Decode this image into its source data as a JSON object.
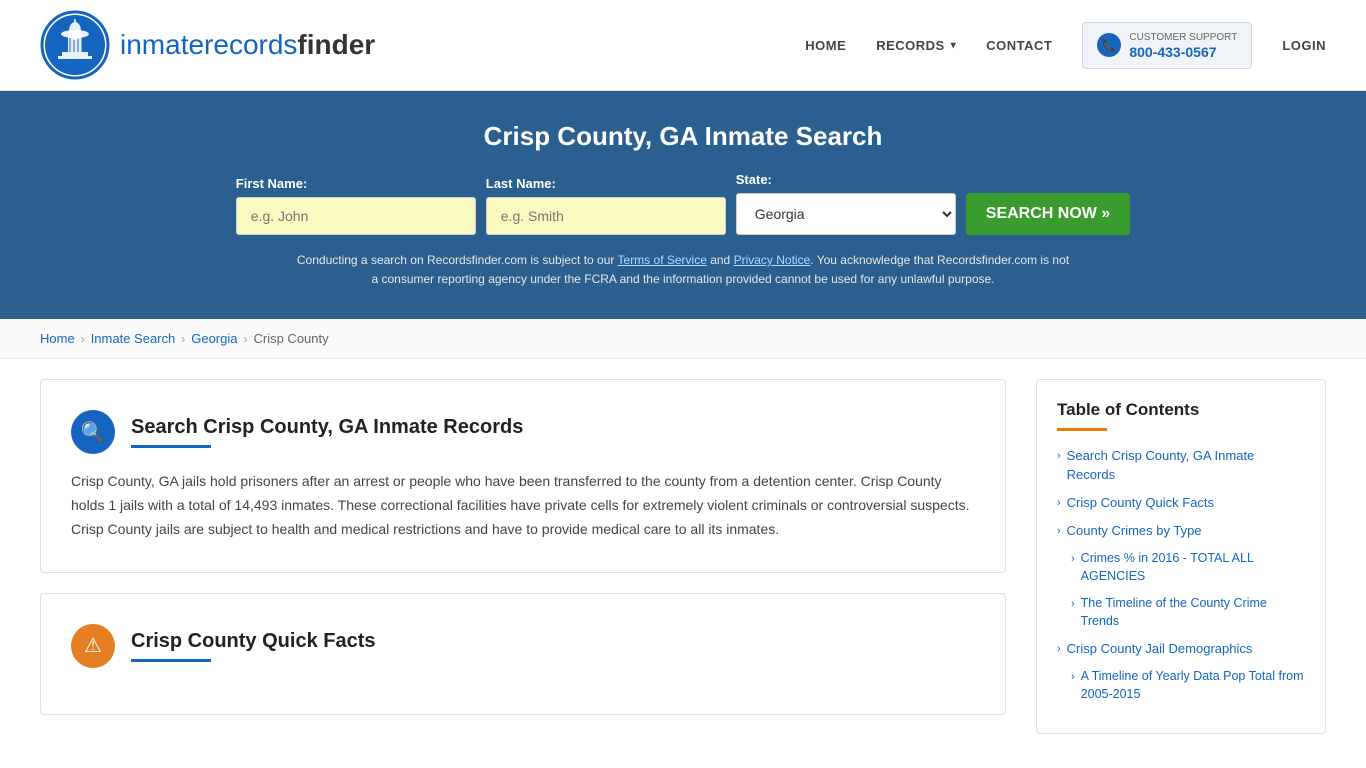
{
  "header": {
    "logo_text_regular": "inmaterecords",
    "logo_text_bold": "finder",
    "nav": {
      "home": "HOME",
      "records": "RECORDS",
      "contact": "CONTACT",
      "login": "LOGIN"
    },
    "support": {
      "label": "CUSTOMER SUPPORT",
      "phone": "800-433-0567"
    }
  },
  "hero": {
    "title": "Crisp County, GA Inmate Search",
    "form": {
      "first_name_label": "First Name:",
      "first_name_placeholder": "e.g. John",
      "last_name_label": "Last Name:",
      "last_name_placeholder": "e.g. Smith",
      "state_label": "State:",
      "state_value": "Georgia",
      "search_button": "SEARCH NOW »"
    },
    "disclaimer": "Conducting a search on Recordsfinder.com is subject to our Terms of Service and Privacy Notice. You acknowledge that Recordsfinder.com is not a consumer reporting agency under the FCRA and the information provided cannot be used for any unlawful purpose."
  },
  "breadcrumb": {
    "items": [
      "Home",
      "Inmate Search",
      "Georgia",
      "Crisp County"
    ]
  },
  "main": {
    "cards": [
      {
        "id": "inmate-records",
        "icon": "🔍",
        "title": "Search Crisp County, GA Inmate Records",
        "body": "Crisp County, GA jails hold prisoners after an arrest or people who have been transferred to the county from a detention center. Crisp County holds 1 jails with a total of 14,493 inmates. These correctional facilities have private cells for extremely violent criminals or controversial suspects. Crisp County jails are subject to health and medical restrictions and have to provide medical care to all its inmates."
      },
      {
        "id": "quick-facts",
        "icon": "⚠",
        "title": "Crisp County Quick Facts",
        "body": ""
      }
    ]
  },
  "sidebar": {
    "toc_title": "Table of Contents",
    "items": [
      {
        "label": "Search Crisp County, GA Inmate Records",
        "sub": false
      },
      {
        "label": "Crisp County Quick Facts",
        "sub": false
      },
      {
        "label": "County Crimes by Type",
        "sub": false
      },
      {
        "label": "Crimes % in 2016 - TOTAL ALL AGENCIES",
        "sub": true
      },
      {
        "label": "The Timeline of the County Crime Trends",
        "sub": true
      },
      {
        "label": "Crisp County Jail Demographics",
        "sub": false
      },
      {
        "label": "A Timeline of Yearly Data Pop Total from 2005-2015",
        "sub": true
      }
    ]
  }
}
